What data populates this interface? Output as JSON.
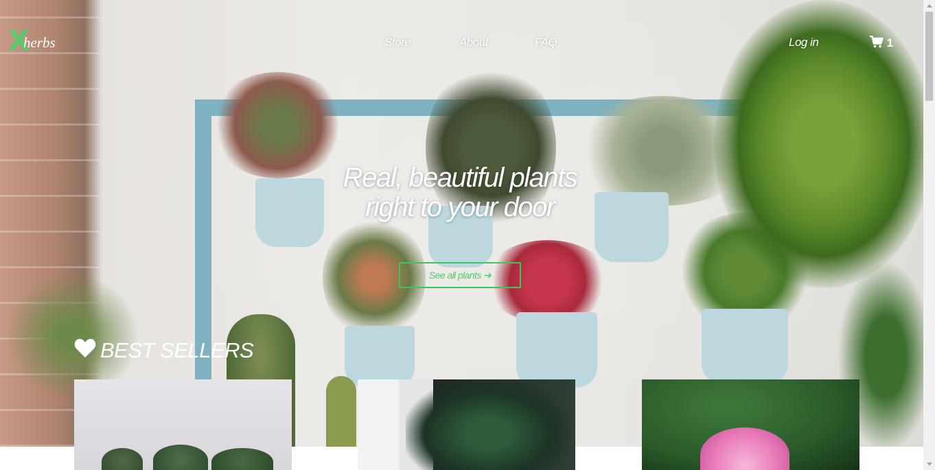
{
  "brand": {
    "logo_mark": "X",
    "logo_text": "herbs"
  },
  "nav": {
    "items": [
      {
        "label": "Store"
      },
      {
        "label": "About"
      },
      {
        "label": "FAQ"
      }
    ],
    "login_label": "Log in",
    "cart_count": "1",
    "cart_icon": "shopping-cart-icon"
  },
  "hero": {
    "headline_line1": "Real, beautiful plants",
    "headline_line2": "right to your door",
    "cta_label": "See all plants",
    "cta_arrow": "➔"
  },
  "section": {
    "title": "BEST SELLERS",
    "icon": "heart-icon"
  },
  "colors": {
    "accent": "#3ec45b",
    "text_light": "#ffffff"
  }
}
